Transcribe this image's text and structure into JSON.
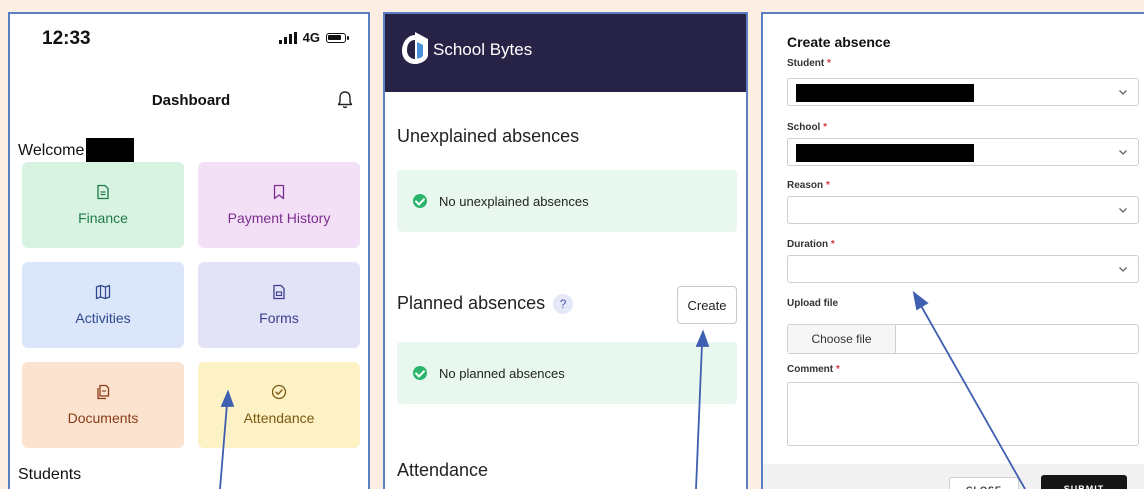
{
  "phone": {
    "status_time": "12:33",
    "network": "4G",
    "title": "Dashboard",
    "welcome": "Welcome",
    "tiles": [
      {
        "label": "Finance",
        "icon": "document-icon"
      },
      {
        "label": "Payment History",
        "icon": "bookmark-icon"
      },
      {
        "label": "Activities",
        "icon": "map-icon"
      },
      {
        "label": "Forms",
        "icon": "form-icon"
      },
      {
        "label": "Documents",
        "icon": "documents-icon"
      },
      {
        "label": "Attendance",
        "icon": "check-circle-icon"
      }
    ],
    "students_heading": "Students"
  },
  "schoolbytes": {
    "brand": "School Bytes",
    "unexplained_title": "Unexplained absences",
    "unexplained_message": "No unexplained absences",
    "planned_title": "Planned absences",
    "planned_help": "?",
    "create_label": "Create",
    "planned_message": "No planned absences",
    "attendance_title": "Attendance"
  },
  "form": {
    "title": "Create absence",
    "student_label": "Student",
    "school_label": "School",
    "reason_label": "Reason",
    "duration_label": "Duration",
    "upload_label": "Upload file",
    "choose_file": "Choose file",
    "comment_label": "Comment",
    "required_mark": "*",
    "close_label": "CLOSE",
    "submit_label": "SUBMIT"
  },
  "colors": {
    "background": "#fdeee3",
    "panel_border": "#5b7fc4",
    "header_navy": "#262347",
    "arrow": "#3f5fb0"
  }
}
